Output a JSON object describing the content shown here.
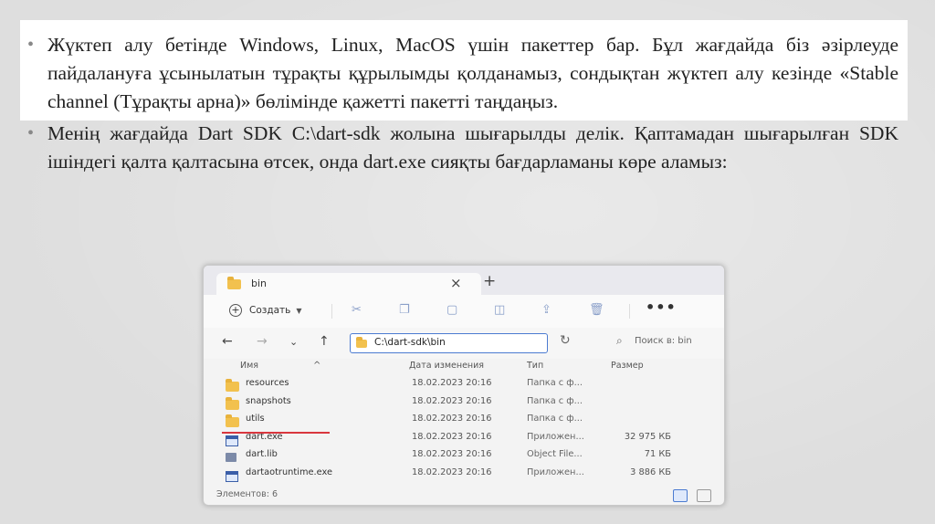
{
  "slide": {
    "bullets": [
      "Жүктеп алу бетінде Windows, Linux, MacOS үшін пакеттер бар. Бұл жағдайда біз әзірлеуде пайдалануға ұсынылатын тұрақты құрылымды қолданамыз, сондықтан жүктеп алу кезінде «Stable channel (Тұрақты арна)» бөлімінде қажетті пакетті таңдаңыз.",
      "Менің жағдайда Dart SDK C:\\dart-sdk жолына шығарылды делік. Қаптамадан шығарылған SDK ішіндегі қалта қалтасына өтсек, онда dart.exe сияқты бағдарламаны көре аламыз:"
    ]
  },
  "explorer": {
    "tab_label": "bin",
    "tab_close": "×",
    "tab_add": "+",
    "create_label": "Создать",
    "address": "C:\\dart-sdk\\bin",
    "search_placeholder": "Поиск в: bin",
    "columns": {
      "name": "Имя",
      "date": "Дата изменения",
      "type": "Тип",
      "size": "Размер"
    },
    "rows": [
      {
        "icon": "folder-icon",
        "name": "resources",
        "date": "18.02.2023 20:16",
        "type": "Папка с ф...",
        "size": ""
      },
      {
        "icon": "folder-icon",
        "name": "snapshots",
        "date": "18.02.2023 20:16",
        "type": "Папка с ф...",
        "size": ""
      },
      {
        "icon": "folder-icon",
        "name": "utils",
        "date": "18.02.2023 20:16",
        "type": "Папка с ф...",
        "size": ""
      },
      {
        "icon": "exe-icon",
        "name": "dart.exe",
        "date": "18.02.2023 20:16",
        "type": "Приложен...",
        "size": "32 975 КБ"
      },
      {
        "icon": "lib-icon",
        "name": "dart.lib",
        "date": "18.02.2023 20:16",
        "type": "Object File...",
        "size": "71 КБ"
      },
      {
        "icon": "exe-icon",
        "name": "dartaotruntime.exe",
        "date": "18.02.2023 20:16",
        "type": "Приложен...",
        "size": "3 886 КБ"
      }
    ],
    "status": "Элементов: 6",
    "highlight_color": "#d9363e"
  }
}
